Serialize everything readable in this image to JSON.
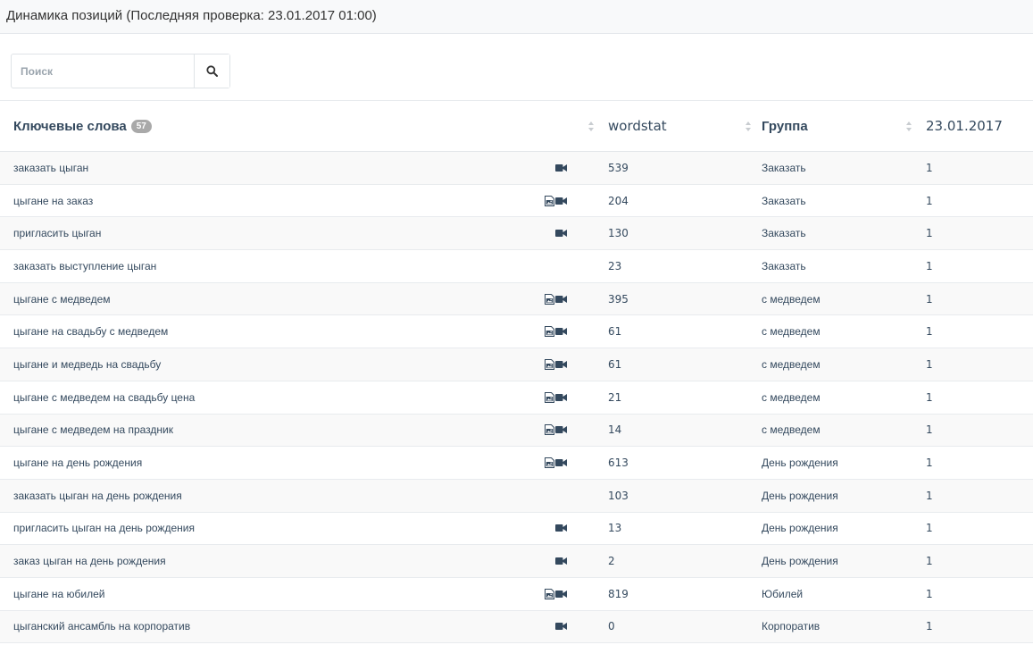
{
  "header": {
    "title": "Динамика позиций (Последняя проверка: 23.01.2017 01:00)"
  },
  "search": {
    "placeholder": "Поиск",
    "value": "",
    "icon": "search-icon"
  },
  "table": {
    "columns": {
      "keywords": "Ключевые слова",
      "keywords_count": "57",
      "wordstat": "wordstat",
      "group": "Группа",
      "date": "23.01.2017"
    },
    "rows": [
      {
        "keyword": "заказать цыган",
        "icons": [
          "video-icon"
        ],
        "wordstat": "539",
        "group": "Заказать",
        "position": "1"
      },
      {
        "keyword": "цыгане на заказ",
        "icons": [
          "image-icon",
          "video-icon"
        ],
        "wordstat": "204",
        "group": "Заказать",
        "position": "1"
      },
      {
        "keyword": "пригласить цыган",
        "icons": [
          "video-icon"
        ],
        "wordstat": "130",
        "group": "Заказать",
        "position": "1"
      },
      {
        "keyword": "заказать выступление цыган",
        "icons": [],
        "wordstat": "23",
        "group": "Заказать",
        "position": "1"
      },
      {
        "keyword": "цыгане с медведем",
        "icons": [
          "image-icon",
          "video-icon"
        ],
        "wordstat": "395",
        "group": "с медведем",
        "position": "1"
      },
      {
        "keyword": "цыгане на свадьбу с медведем",
        "icons": [
          "image-icon",
          "video-icon"
        ],
        "wordstat": "61",
        "group": "с медведем",
        "position": "1"
      },
      {
        "keyword": "цыгане и медведь на свадьбу",
        "icons": [
          "image-icon",
          "video-icon"
        ],
        "wordstat": "61",
        "group": "с медведем",
        "position": "1"
      },
      {
        "keyword": "цыгане с медведем на свадьбу цена",
        "icons": [
          "image-icon",
          "video-icon"
        ],
        "wordstat": "21",
        "group": "с медведем",
        "position": "1"
      },
      {
        "keyword": "цыгане с медведем на праздник",
        "icons": [
          "image-icon",
          "video-icon"
        ],
        "wordstat": "14",
        "group": "с медведем",
        "position": "1"
      },
      {
        "keyword": "цыгане на день рождения",
        "icons": [
          "image-icon",
          "video-icon"
        ],
        "wordstat": "613",
        "group": "День рождения",
        "position": "1"
      },
      {
        "keyword": "заказать цыган на день рождения",
        "icons": [],
        "wordstat": "103",
        "group": "День рождения",
        "position": "1"
      },
      {
        "keyword": "пригласить цыган на день рождения",
        "icons": [
          "video-icon"
        ],
        "wordstat": "13",
        "group": "День рождения",
        "position": "1"
      },
      {
        "keyword": "заказ цыган на день рождения",
        "icons": [
          "video-icon"
        ],
        "wordstat": "2",
        "group": "День рождения",
        "position": "1"
      },
      {
        "keyword": "цыгане на юбилей",
        "icons": [
          "image-icon",
          "video-icon"
        ],
        "wordstat": "819",
        "group": "Юбилей",
        "position": "1"
      },
      {
        "keyword": "цыганский ансамбль на корпоратив",
        "icons": [
          "video-icon"
        ],
        "wordstat": "0",
        "group": "Корпоратив",
        "position": "1"
      }
    ]
  }
}
